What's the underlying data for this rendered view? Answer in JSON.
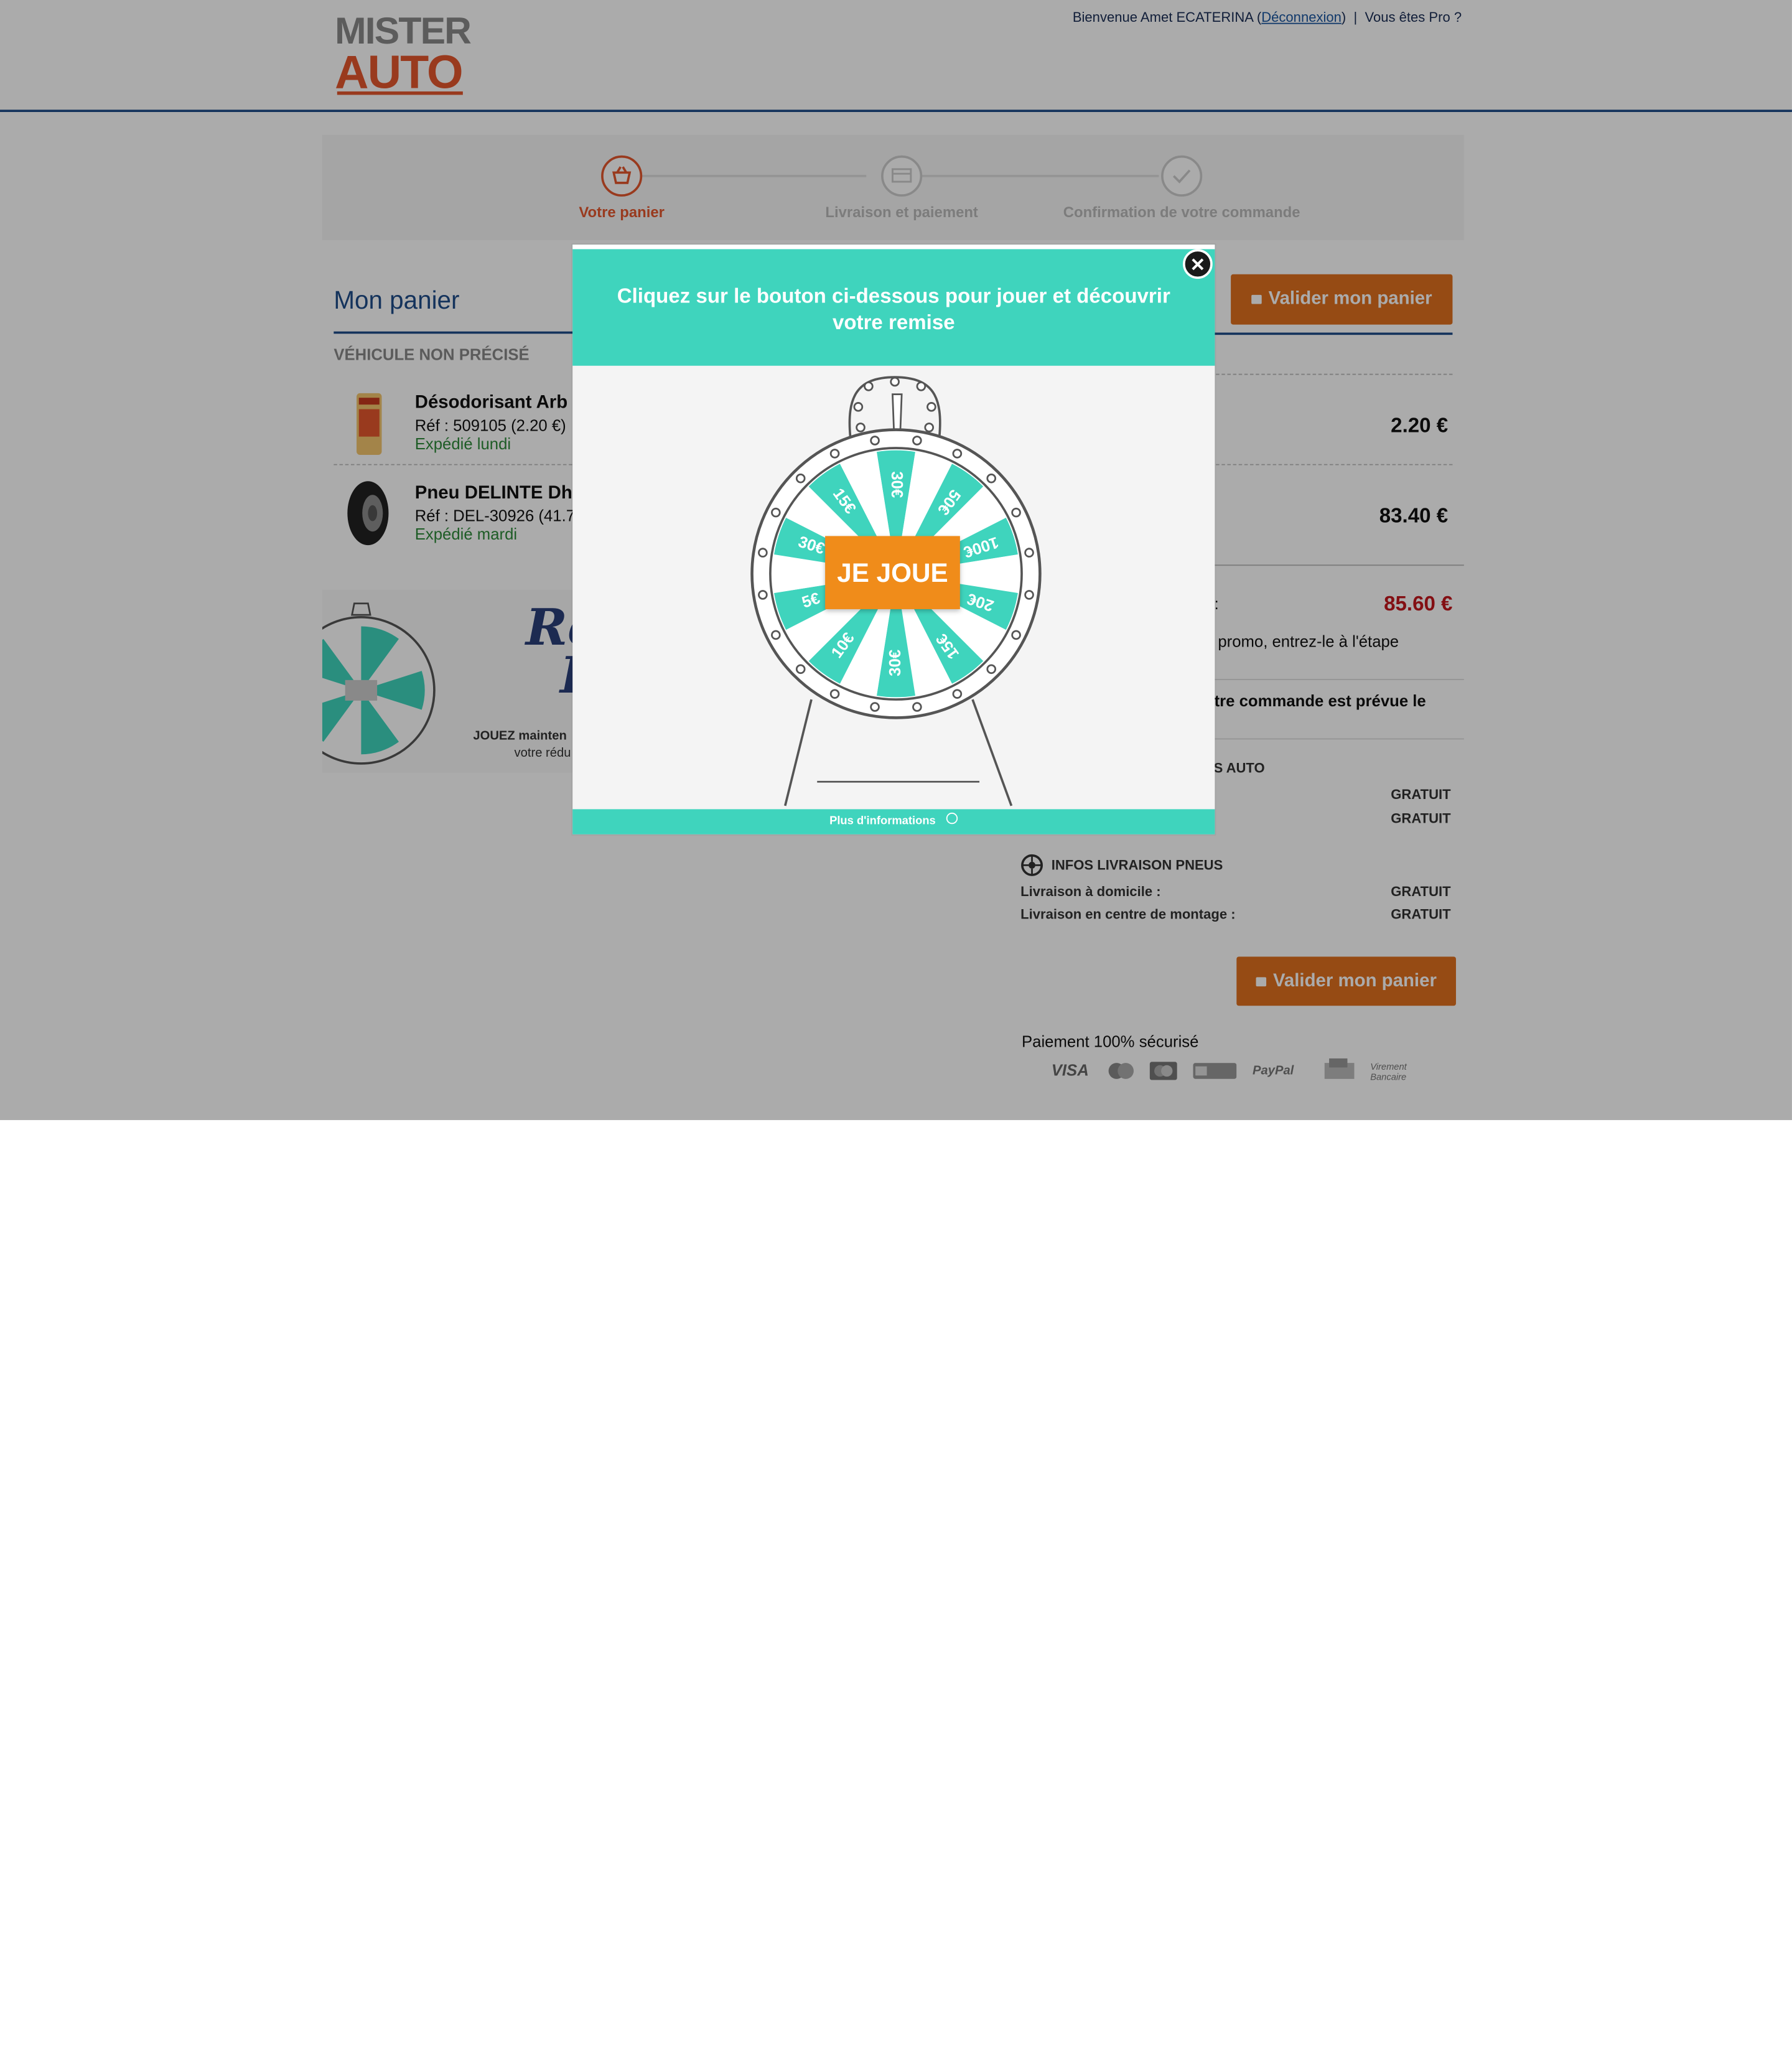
{
  "header": {
    "logo_top": "MISTER",
    "logo_bottom": "AUTO",
    "welcome": "Bienvenue Amet ECATERINA (",
    "logout": "Déconnexion",
    "welcome_end": ")",
    "separator": "|",
    "pro_link": "Vous êtes Pro ?"
  },
  "steps": [
    {
      "label": "Votre panier"
    },
    {
      "label": "Livraison et paiement"
    },
    {
      "label": "Confirmation de votre commande"
    }
  ],
  "cart": {
    "title": "Mon panier",
    "vehicle": "VÉHICULE NON PRÉCISÉ",
    "items": [
      {
        "name": "Désodorisant Arb",
        "ref": "Réf : 509105 (2.20 €)",
        "shipping": "Expédié lundi",
        "price": "2.20 €"
      },
      {
        "name": "Pneu DELINTE Dh",
        "ref": "Réf : DEL-30926 (41.7",
        "shipping": "Expédié mardi",
        "price": "83.40 €"
      }
    ]
  },
  "promo_banner": {
    "script_1": "Ré",
    "script_2": "I",
    "line_1": "JOUEZ mainten",
    "line_2": "votre rédu"
  },
  "summary": {
    "validate_label": "Valider mon panier",
    "total_label_fragment": ") :",
    "total_value": "85.60 €",
    "promo_text": "e promo, entrez-le à l'étape",
    "delivery_text": "otre commande est prévue le",
    "infos_auto_title": "ES AUTO",
    "free": "GRATUIT",
    "infos_tyre_title": "INFOS LIVRAISON PNEUS",
    "home_delivery": "Livraison à domicile :",
    "center_delivery": "Livraison en centre de montage :",
    "secure_payment": "Paiement 100% sécurisé",
    "pay_methods": [
      "VISA",
      "PayPal",
      "Virement Bancaire"
    ]
  },
  "modal": {
    "title": "Cliquez sur le bouton ci-dessous pour jouer et découvrir votre remise",
    "play_button": "JE JOUE",
    "more_info": "Plus d'informations",
    "close_symbol": "✕",
    "wheel_segments": [
      "30€",
      "50€",
      "100€",
      "20€",
      "15€",
      "30€",
      "10€",
      "5€",
      "30€",
      "15€"
    ],
    "colors": {
      "teal": "#3fd4bd",
      "orange": "#f08c1a"
    }
  },
  "colors": {
    "brand_blue": "#1f4c8a",
    "brand_orange": "#e4572e",
    "button_orange": "#e0701f",
    "total_red": "#c4171d"
  }
}
